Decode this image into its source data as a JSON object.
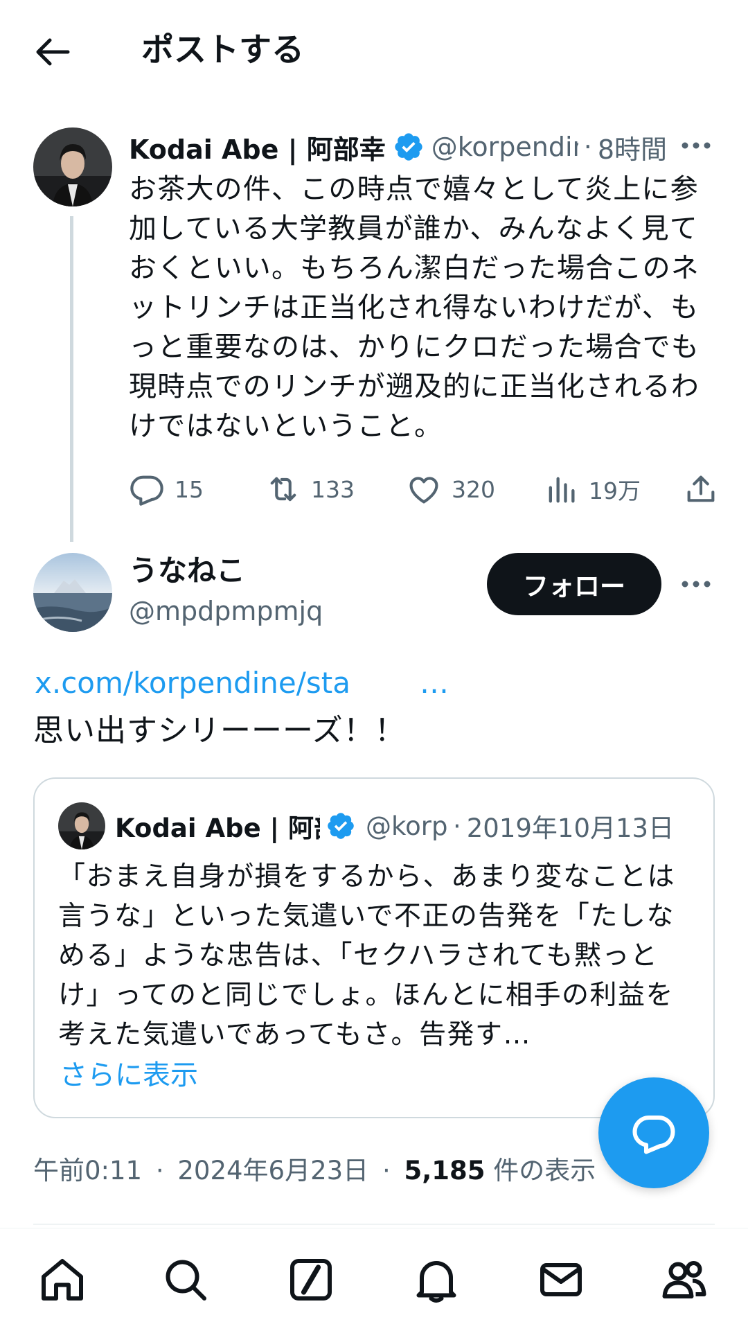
{
  "header": {
    "title": "ポストする",
    "back_icon": "arrow-left-icon"
  },
  "parent_post": {
    "name": "Kodai Abe | 阿部幸",
    "handle": "@korpendine",
    "time": "8時間",
    "separator": "·",
    "text": "お茶大の件、この時点で嬉々として炎上に参加している大学教員が誰か、みんなよく見ておくといい。もちろん潔白だった場合このネットリンチは正当化され得ないわけだが、もっと重要なのは、かりにクロだった場合でも現時点でのリンチが遡及的に正当化されるわけではないということ。",
    "actions": {
      "replies": "15",
      "reposts": "133",
      "likes": "320",
      "views": "19万"
    }
  },
  "main_post": {
    "name": "うなねこ",
    "handle": "@mpdpmpmjq",
    "follow_label": "フォロー",
    "link_text": "x.com/korpendine/sta",
    "link_ellipsis": "…",
    "text": "思い出すシリーーーズ！！",
    "quote": {
      "name": "Kodai Abe | 阿部",
      "handle": "@korp",
      "separator": "·",
      "date": "2019年10月13日",
      "text": "「おまえ自身が損をするから、あまり変なことは言うな」といった気遣いで不正の告発を「たしなめる」ような忠告は、「セクハラされても黙っとけ」ってのと同じでしょ。ほんとに相手の利益を考えた気遣いであってもさ。告発す…",
      "show_more": "さらに表示"
    },
    "meta": {
      "time": "午前0:11",
      "date": "2024年6月23日",
      "separator": "·",
      "views_count": "5,185",
      "views_suffix": "件の表示"
    }
  },
  "bottom_nav": [
    "home-icon",
    "search-icon",
    "grok-icon",
    "notifications-icon",
    "messages-icon",
    "communities-icon"
  ],
  "colors": {
    "accent": "#1d9bf0",
    "text": "#0f1419",
    "secondary": "#536471",
    "border": "#cfd9de"
  }
}
